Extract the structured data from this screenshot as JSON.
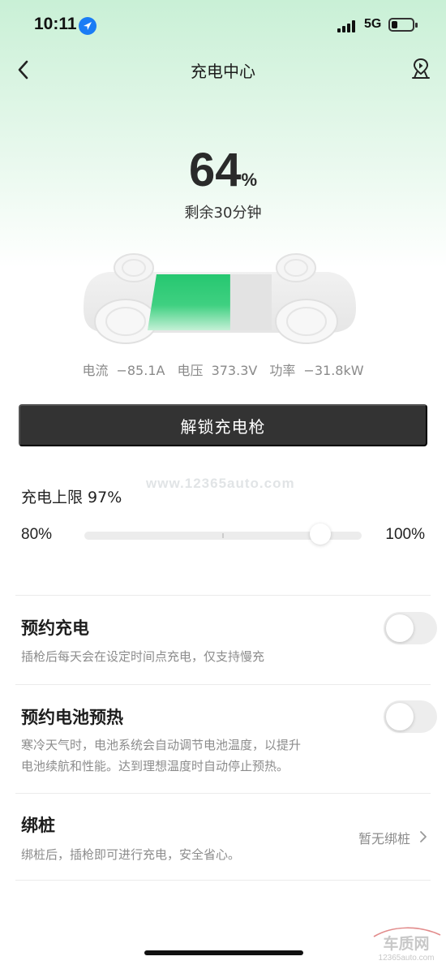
{
  "status_bar": {
    "time": "10:11",
    "network": "5G",
    "location_icon": "location-arrow-icon",
    "signal_icon": "cellular-signal-icon",
    "battery_icon": "battery-icon",
    "battery_level": 0.3
  },
  "header": {
    "title": "充电中心",
    "back_icon": "chevron-left-icon",
    "right_icon": "map-pin-icon"
  },
  "charging": {
    "percent": "64",
    "percent_unit": "%",
    "battery_fill": 0.64,
    "remaining": "剩余30分钟",
    "metrics": [
      {
        "label": "电流",
        "value": "−85.1A"
      },
      {
        "label": "电压",
        "value": "373.3V"
      },
      {
        "label": "功率",
        "value": "−31.8kW"
      }
    ]
  },
  "actions": {
    "unlock_label": "解锁充电枪"
  },
  "watermark": {
    "text": "www.12365auto.com"
  },
  "charge_limit": {
    "title": "充电上限 97%",
    "min_label": "80%",
    "max_label": "100%",
    "value": 97,
    "min": 80,
    "max": 100
  },
  "settings": {
    "scheduled_charge": {
      "title": "预约充电",
      "desc": "插枪后每天会在设定时间点充电，仅支持慢充",
      "enabled": false
    },
    "battery_preheat": {
      "title": "预约电池预热",
      "desc_line1": "寒冷天气时，电池系统会自动调节电池温度，以提升",
      "desc_line2": "电池续航和性能。达到理想温度时自动停止预热。",
      "enabled": false
    },
    "bind_charger": {
      "title": "绑桩",
      "desc": "绑桩后，插枪即可进行充电，安全省心。",
      "status": "暂无绑桩",
      "chevron_icon": "chevron-right-icon"
    }
  },
  "logo": {
    "text": "车质网",
    "url_text": "12365auto.com"
  },
  "colors": {
    "accent_green": "#21c46a",
    "button_dark": "#333333",
    "muted_text": "#8c8c8c"
  }
}
